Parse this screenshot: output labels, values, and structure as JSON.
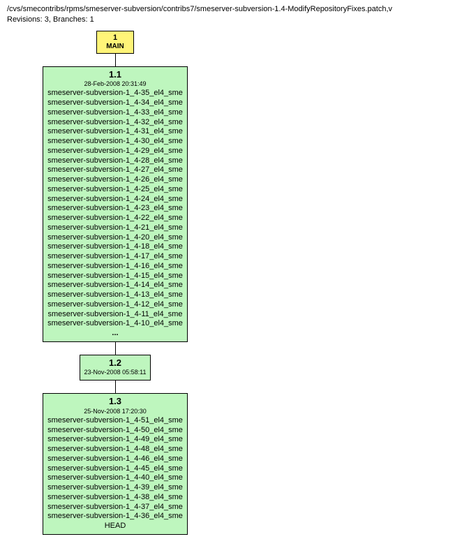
{
  "header": {
    "path": "/cvs/smecontribs/rpms/smeserver-subversion/contribs7/smeserver-subversion-1.4-ModifyRepositoryFixes.patch,v",
    "stats": "Revisions: 3, Branches: 1"
  },
  "branch": {
    "num": "1",
    "name": "MAIN"
  },
  "nodes": [
    {
      "version": "1.1",
      "date": "28-Feb-2008 20:31:49",
      "more": "...",
      "tags": [
        "smeserver-subversion-1_4-35_el4_sme",
        "smeserver-subversion-1_4-34_el4_sme",
        "smeserver-subversion-1_4-33_el4_sme",
        "smeserver-subversion-1_4-32_el4_sme",
        "smeserver-subversion-1_4-31_el4_sme",
        "smeserver-subversion-1_4-30_el4_sme",
        "smeserver-subversion-1_4-29_el4_sme",
        "smeserver-subversion-1_4-28_el4_sme",
        "smeserver-subversion-1_4-27_el4_sme",
        "smeserver-subversion-1_4-26_el4_sme",
        "smeserver-subversion-1_4-25_el4_sme",
        "smeserver-subversion-1_4-24_el4_sme",
        "smeserver-subversion-1_4-23_el4_sme",
        "smeserver-subversion-1_4-22_el4_sme",
        "smeserver-subversion-1_4-21_el4_sme",
        "smeserver-subversion-1_4-20_el4_sme",
        "smeserver-subversion-1_4-18_el4_sme",
        "smeserver-subversion-1_4-17_el4_sme",
        "smeserver-subversion-1_4-16_el4_sme",
        "smeserver-subversion-1_4-15_el4_sme",
        "smeserver-subversion-1_4-14_el4_sme",
        "smeserver-subversion-1_4-13_el4_sme",
        "smeserver-subversion-1_4-12_el4_sme",
        "smeserver-subversion-1_4-11_el4_sme",
        "smeserver-subversion-1_4-10_el4_sme"
      ]
    },
    {
      "version": "1.2",
      "date": "23-Nov-2008 05:58:11",
      "tags": []
    },
    {
      "version": "1.3",
      "date": "25-Nov-2008 17:20:30",
      "tags": [
        "smeserver-subversion-1_4-51_el4_sme",
        "smeserver-subversion-1_4-50_el4_sme",
        "smeserver-subversion-1_4-49_el4_sme",
        "smeserver-subversion-1_4-48_el4_sme",
        "smeserver-subversion-1_4-46_el4_sme",
        "smeserver-subversion-1_4-45_el4_sme",
        "smeserver-subversion-1_4-40_el4_sme",
        "smeserver-subversion-1_4-39_el4_sme",
        "smeserver-subversion-1_4-38_el4_sme",
        "smeserver-subversion-1_4-37_el4_sme",
        "smeserver-subversion-1_4-36_el4_sme",
        "HEAD"
      ]
    }
  ]
}
